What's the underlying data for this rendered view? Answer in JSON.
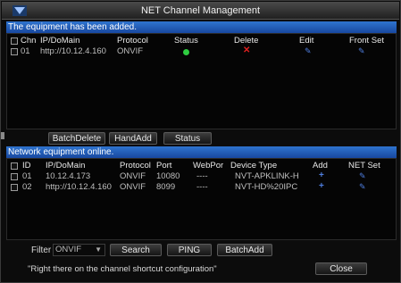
{
  "window": {
    "title": "NET Channel Management"
  },
  "added": {
    "section_title": "The equipment has been added.",
    "columns": [
      "Chn",
      "IP/DoMain",
      "Protocol",
      "Status",
      "Delete",
      "Edit",
      "Front Set"
    ],
    "rows": [
      {
        "chn": "01",
        "ip": "http://10.12.4.160",
        "protocol": "ONVIF",
        "status": "online",
        "delete_icon": "x-icon",
        "edit_icon": "pencil-icon",
        "front_set_icon": "pencil-icon"
      }
    ]
  },
  "toolbar": {
    "batch_delete": "BatchDelete",
    "hand_add": "HandAdd",
    "status": "Status"
  },
  "online": {
    "section_title": "Network equipment online.",
    "columns": [
      "ID",
      "IP/DoMain",
      "Protocol",
      "Port",
      "WebPor",
      "Device Type",
      "Add",
      "NET Set"
    ],
    "rows": [
      {
        "id": "01",
        "ip": "10.12.4.173",
        "protocol": "ONVIF",
        "port": "10080",
        "webport": "----",
        "device_type": "NVT-APKLINK-H",
        "add_icon": "plus-icon",
        "net_set_icon": "pencil-icon"
      },
      {
        "id": "02",
        "ip": "http://10.12.4.160",
        "protocol": "ONVIF",
        "port": "8099",
        "webport": "----",
        "device_type": "NVT-HD%20IPC",
        "add_icon": "plus-icon",
        "net_set_icon": "pencil-icon"
      }
    ]
  },
  "filter": {
    "label": "Filter",
    "value": "ONVIF"
  },
  "buttons": {
    "search": "Search",
    "ping": "PING",
    "batch_add": "BatchAdd",
    "close": "Close"
  },
  "hint": "\"Right there on the channel shortcut configuration\"",
  "colors": {
    "section_bar": "#2f74cf",
    "status_online": "#2ecc40",
    "delete": "#e02020",
    "action": "#4f7fe0"
  }
}
